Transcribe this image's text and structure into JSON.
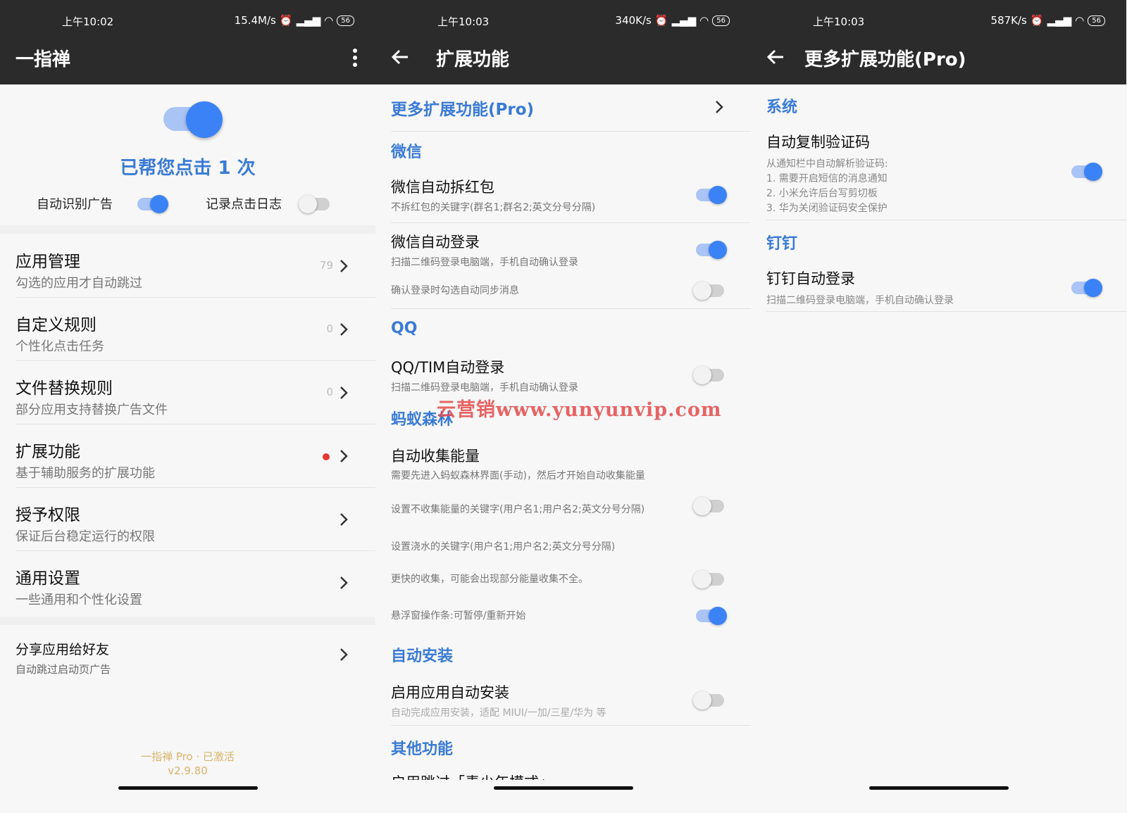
{
  "screen1": {
    "status": {
      "time": "上午10:02",
      "speed": "15.4M/s",
      "battery": "56"
    },
    "title": "一指禅",
    "clicks_text": "已帮您点击 1 次",
    "auto_ad_label": "自动识别广告",
    "log_label": "记录点击日志",
    "items": [
      {
        "title": "应用管理",
        "sub": "勾选的应用才自动跳过",
        "count": "79"
      },
      {
        "title": "自定义规则",
        "sub": "个性化点击任务",
        "count": "0"
      },
      {
        "title": "文件替换规则",
        "sub": "部分应用支持替换广告文件",
        "count": "0"
      },
      {
        "title": "扩展功能",
        "sub": "基于辅助服务的扩展功能",
        "count": ""
      },
      {
        "title": "授予权限",
        "sub": "保证后台稳定运行的权限",
        "count": ""
      },
      {
        "title": "通用设置",
        "sub": "一些通用和个性化设置",
        "count": ""
      }
    ],
    "share": {
      "title": "分享应用给好友",
      "sub": "自动跳过启动页广告"
    },
    "footer": {
      "line1": "一指禅 Pro · 已激活",
      "line2": "v2.9.80"
    }
  },
  "screen2": {
    "status": {
      "time": "上午10:03",
      "speed": "340K/s",
      "battery": "56"
    },
    "title": "扩展功能",
    "pro_link": "更多扩展功能(Pro)",
    "sections": {
      "wechat": "微信",
      "qq": "QQ",
      "ant": "蚂蚁森林",
      "install": "自动安装",
      "other": "其他功能"
    },
    "wechat_redpack": {
      "title": "微信自动拆红包",
      "sub": "不拆红包的关键字(群名1;群名2;英文分号分隔)"
    },
    "wechat_login": {
      "title": "微信自动登录",
      "sub": "扫描二维码登录电脑端，手机自动确认登录",
      "sync": "确认登录时勾选自动同步消息"
    },
    "qq_login": {
      "title": "QQ/TIM自动登录",
      "sub": "扫描二维码登录电脑端，手机自动确认登录"
    },
    "ant_collect": {
      "title": "自动收集能量",
      "sub": "需要先进入蚂蚁森林界面(手动)，然后才开始自动收集能量",
      "nocollect": "设置不收集能量的关键字(用户名1;用户名2;英文分号分隔)",
      "water": "设置浇水的关键字(用户名1;用户名2;英文分号分隔)",
      "fast": "更快的收集，可能会出现部分能量收集不全。",
      "float": "悬浮窗操作条:可暂停/重新开始"
    },
    "install_item": {
      "title": "启用应用自动安装",
      "sub": "自动完成应用安装，适配 MIUI/一加/三星/华为 等"
    },
    "other_item": {
      "title": "启用跳过「青少年模式」"
    },
    "watermark": "云营销www.yunyunvip.com"
  },
  "screen3": {
    "status": {
      "time": "上午10:03",
      "speed": "587K/s",
      "battery": "56"
    },
    "title": "更多扩展功能(Pro)",
    "sections": {
      "system": "系统",
      "dingtalk": "钉钉"
    },
    "sms": {
      "title": "自动复制验证码",
      "sub1": "从通知栏中自动解析验证码:",
      "sub2": "1. 需要开启短信的消息通知",
      "sub3": "2. 小米允许后台写剪切板",
      "sub4": "3. 华为关闭验证码安全保护"
    },
    "ding_login": {
      "title": "钉钉自动登录",
      "sub": "扫描二维码登录电脑端，手机自动确认登录"
    }
  },
  "colors": {
    "accent": "#3b82f6",
    "section": "#3a7bd5",
    "appbar": "#2b2b2b",
    "red_dot": "#e53935"
  },
  "toggles": {
    "master": true,
    "auto_ad": true,
    "log": false,
    "wechat_redpack": true,
    "wechat_login": true,
    "wechat_sync": false,
    "qq_login": false,
    "ant_nocollect": false,
    "ant_fast": false,
    "ant_float": true,
    "install": false,
    "sms": true,
    "ding": true
  }
}
